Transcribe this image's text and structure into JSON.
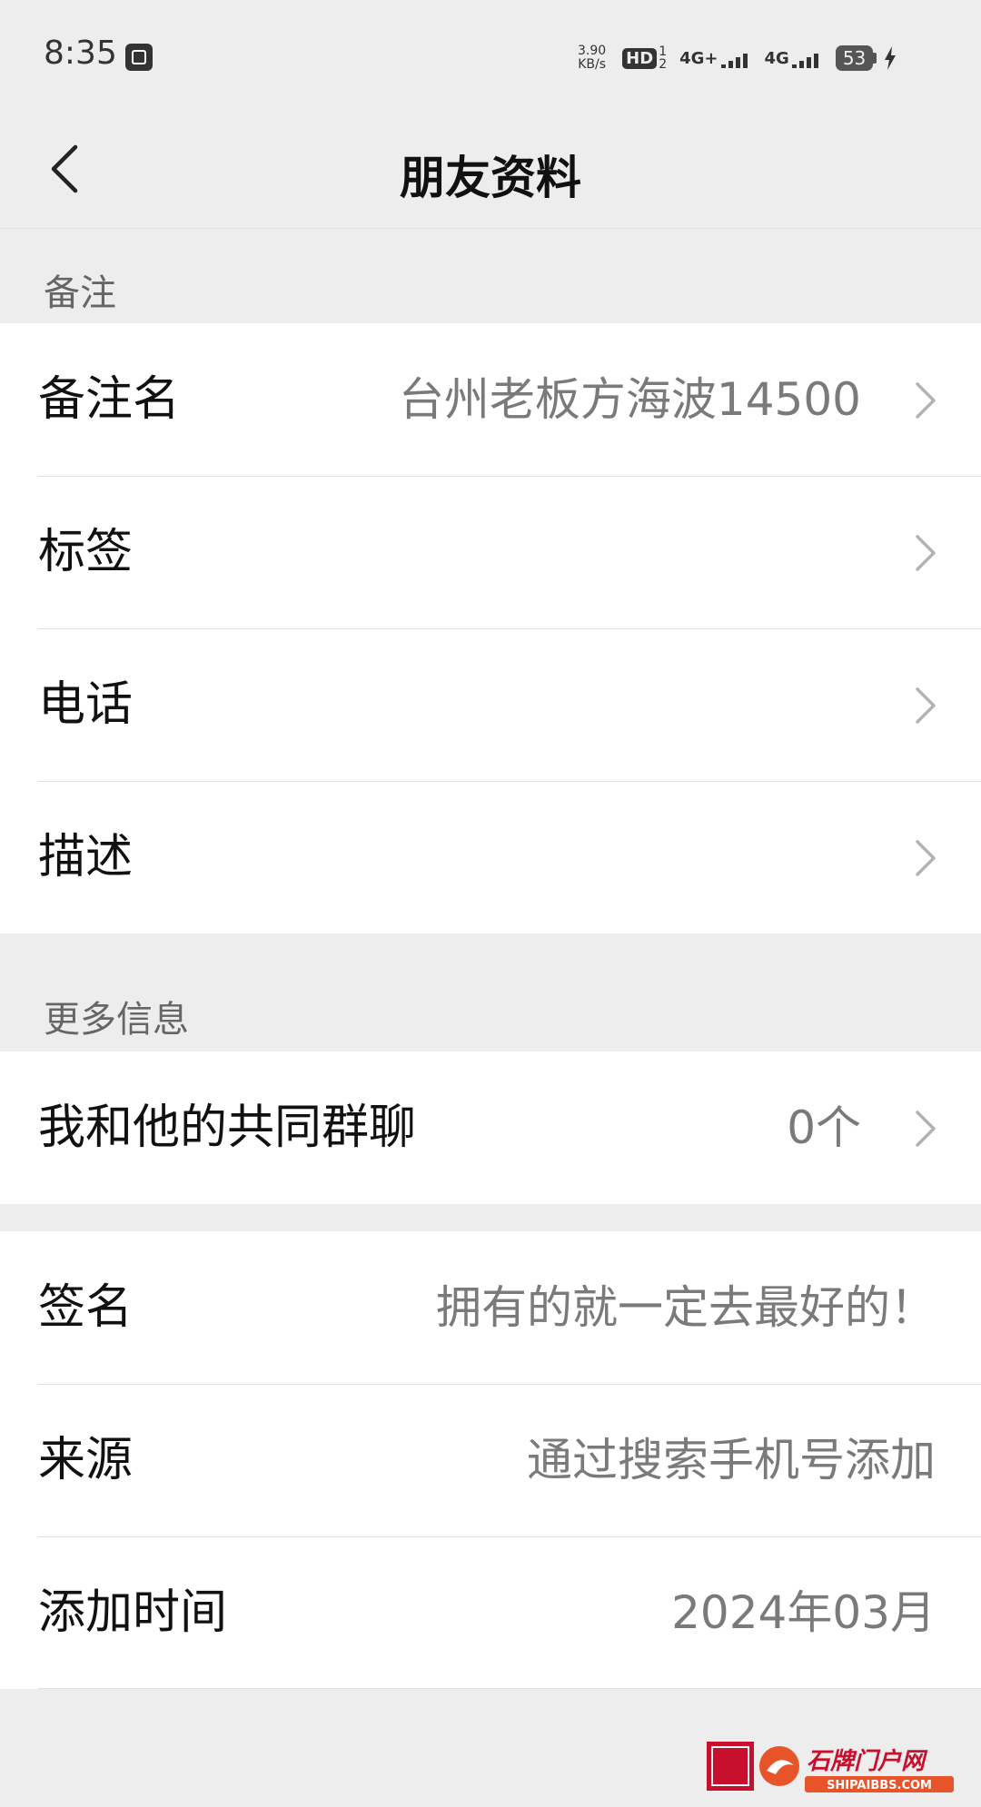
{
  "status_bar": {
    "time": "8:35",
    "net_speed_value": "3.90",
    "net_speed_unit": "KB/s",
    "hd_label": "HD",
    "hd_sub_top": "1",
    "hd_sub_bottom": "2",
    "sim1_label": "4G+",
    "sim2_label": "4G",
    "battery": "53"
  },
  "header": {
    "title": "朋友资料"
  },
  "remark_section": {
    "label": "备注",
    "rows": [
      {
        "label": "备注名",
        "value": "台州老板方海波14500"
      },
      {
        "label": "标签",
        "value": ""
      },
      {
        "label": "电话",
        "value": ""
      },
      {
        "label": "描述",
        "value": ""
      }
    ]
  },
  "more_section": {
    "label": "更多信息",
    "common_groups": {
      "label": "我和他的共同群聊",
      "value": "0个"
    }
  },
  "info_rows": [
    {
      "label": "签名",
      "value": "拥有的就一定去最好的！"
    },
    {
      "label": "来源",
      "value": "通过搜索手机号添加"
    },
    {
      "label": "添加时间",
      "value": "2024年03月"
    }
  ],
  "watermark": {
    "text": "石牌门户网",
    "url": "SHIPAIBBS.COM"
  }
}
